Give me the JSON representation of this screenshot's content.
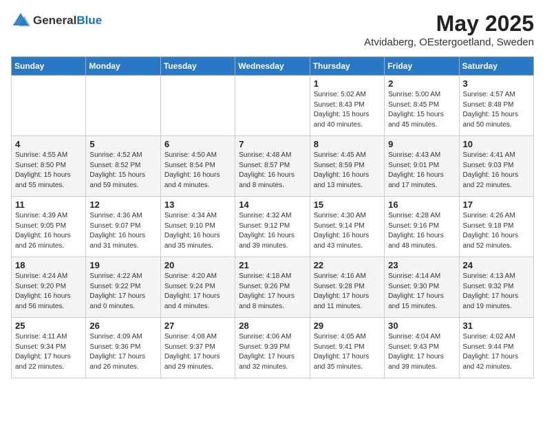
{
  "header": {
    "logo_general": "General",
    "logo_blue": "Blue",
    "month_title": "May 2025",
    "location": "Atvidaberg, OEstergoetland, Sweden"
  },
  "days_of_week": [
    "Sunday",
    "Monday",
    "Tuesday",
    "Wednesday",
    "Thursday",
    "Friday",
    "Saturday"
  ],
  "weeks": [
    [
      {
        "num": "",
        "detail": ""
      },
      {
        "num": "",
        "detail": ""
      },
      {
        "num": "",
        "detail": ""
      },
      {
        "num": "",
        "detail": ""
      },
      {
        "num": "1",
        "detail": "Sunrise: 5:02 AM\nSunset: 8:43 PM\nDaylight: 15 hours\nand 40 minutes."
      },
      {
        "num": "2",
        "detail": "Sunrise: 5:00 AM\nSunset: 8:45 PM\nDaylight: 15 hours\nand 45 minutes."
      },
      {
        "num": "3",
        "detail": "Sunrise: 4:57 AM\nSunset: 8:48 PM\nDaylight: 15 hours\nand 50 minutes."
      }
    ],
    [
      {
        "num": "4",
        "detail": "Sunrise: 4:55 AM\nSunset: 8:50 PM\nDaylight: 15 hours\nand 55 minutes."
      },
      {
        "num": "5",
        "detail": "Sunrise: 4:52 AM\nSunset: 8:52 PM\nDaylight: 15 hours\nand 59 minutes."
      },
      {
        "num": "6",
        "detail": "Sunrise: 4:50 AM\nSunset: 8:54 PM\nDaylight: 16 hours\nand 4 minutes."
      },
      {
        "num": "7",
        "detail": "Sunrise: 4:48 AM\nSunset: 8:57 PM\nDaylight: 16 hours\nand 8 minutes."
      },
      {
        "num": "8",
        "detail": "Sunrise: 4:45 AM\nSunset: 8:59 PM\nDaylight: 16 hours\nand 13 minutes."
      },
      {
        "num": "9",
        "detail": "Sunrise: 4:43 AM\nSunset: 9:01 PM\nDaylight: 16 hours\nand 17 minutes."
      },
      {
        "num": "10",
        "detail": "Sunrise: 4:41 AM\nSunset: 9:03 PM\nDaylight: 16 hours\nand 22 minutes."
      }
    ],
    [
      {
        "num": "11",
        "detail": "Sunrise: 4:39 AM\nSunset: 9:05 PM\nDaylight: 16 hours\nand 26 minutes."
      },
      {
        "num": "12",
        "detail": "Sunrise: 4:36 AM\nSunset: 9:07 PM\nDaylight: 16 hours\nand 31 minutes."
      },
      {
        "num": "13",
        "detail": "Sunrise: 4:34 AM\nSunset: 9:10 PM\nDaylight: 16 hours\nand 35 minutes."
      },
      {
        "num": "14",
        "detail": "Sunrise: 4:32 AM\nSunset: 9:12 PM\nDaylight: 16 hours\nand 39 minutes."
      },
      {
        "num": "15",
        "detail": "Sunrise: 4:30 AM\nSunset: 9:14 PM\nDaylight: 16 hours\nand 43 minutes."
      },
      {
        "num": "16",
        "detail": "Sunrise: 4:28 AM\nSunset: 9:16 PM\nDaylight: 16 hours\nand 48 minutes."
      },
      {
        "num": "17",
        "detail": "Sunrise: 4:26 AM\nSunset: 9:18 PM\nDaylight: 16 hours\nand 52 minutes."
      }
    ],
    [
      {
        "num": "18",
        "detail": "Sunrise: 4:24 AM\nSunset: 9:20 PM\nDaylight: 16 hours\nand 56 minutes."
      },
      {
        "num": "19",
        "detail": "Sunrise: 4:22 AM\nSunset: 9:22 PM\nDaylight: 17 hours\nand 0 minutes."
      },
      {
        "num": "20",
        "detail": "Sunrise: 4:20 AM\nSunset: 9:24 PM\nDaylight: 17 hours\nand 4 minutes."
      },
      {
        "num": "21",
        "detail": "Sunrise: 4:18 AM\nSunset: 9:26 PM\nDaylight: 17 hours\nand 8 minutes."
      },
      {
        "num": "22",
        "detail": "Sunrise: 4:16 AM\nSunset: 9:28 PM\nDaylight: 17 hours\nand 11 minutes."
      },
      {
        "num": "23",
        "detail": "Sunrise: 4:14 AM\nSunset: 9:30 PM\nDaylight: 17 hours\nand 15 minutes."
      },
      {
        "num": "24",
        "detail": "Sunrise: 4:13 AM\nSunset: 9:32 PM\nDaylight: 17 hours\nand 19 minutes."
      }
    ],
    [
      {
        "num": "25",
        "detail": "Sunrise: 4:11 AM\nSunset: 9:34 PM\nDaylight: 17 hours\nand 22 minutes."
      },
      {
        "num": "26",
        "detail": "Sunrise: 4:09 AM\nSunset: 9:36 PM\nDaylight: 17 hours\nand 26 minutes."
      },
      {
        "num": "27",
        "detail": "Sunrise: 4:08 AM\nSunset: 9:37 PM\nDaylight: 17 hours\nand 29 minutes."
      },
      {
        "num": "28",
        "detail": "Sunrise: 4:06 AM\nSunset: 9:39 PM\nDaylight: 17 hours\nand 32 minutes."
      },
      {
        "num": "29",
        "detail": "Sunrise: 4:05 AM\nSunset: 9:41 PM\nDaylight: 17 hours\nand 35 minutes."
      },
      {
        "num": "30",
        "detail": "Sunrise: 4:04 AM\nSunset: 9:43 PM\nDaylight: 17 hours\nand 39 minutes."
      },
      {
        "num": "31",
        "detail": "Sunrise: 4:02 AM\nSunset: 9:44 PM\nDaylight: 17 hours\nand 42 minutes."
      }
    ]
  ]
}
